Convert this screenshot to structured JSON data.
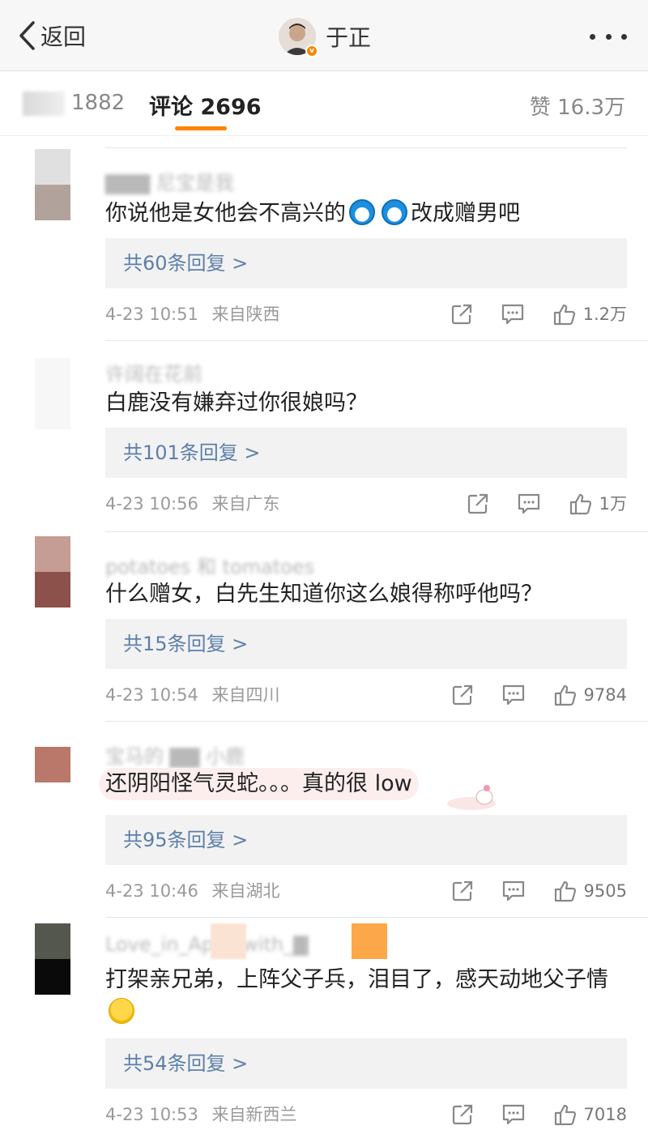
{
  "nav": {
    "back_label": "返回",
    "author_name": "于正",
    "verified_badge": "v"
  },
  "tabs": {
    "repost_count": "1882",
    "comment_label": "评论 2696",
    "likes_label": "赞 16.3万"
  },
  "comments": [
    {
      "text": "你说他是女他会不高兴的",
      "text_after": "改成赠男吧",
      "replies": "共60条回复 >",
      "time": "4-23 10:51",
      "location": "来自陕西",
      "likes": "1.2万"
    },
    {
      "text": "白鹿没有嫌弃过你很娘吗？",
      "replies": "共101条回复 >",
      "time": "4-23 10:56",
      "location": "来自广东",
      "likes": "1万"
    },
    {
      "text": "什么赠女，白先生知道你这么娘得称呼他吗？",
      "replies": "共15条回复 >",
      "time": "4-23 10:54",
      "location": "来自四川",
      "likes": "9784"
    },
    {
      "text": "还阴阳怪气灵蛇。。。真的很 low",
      "replies": "共95条回复 >",
      "time": "4-23 10:46",
      "location": "来自湖北",
      "likes": "9505"
    },
    {
      "text": "打架亲兄弟，上阵父子兵，泪目了，感天动地父子情",
      "replies": "共54条回复 >",
      "time": "4-23 10:53",
      "location": "来自新西兰",
      "likes": "7018"
    }
  ],
  "colors": {
    "accent": "#ff8200",
    "reply_link": "#5d7fa8",
    "meta_gray": "#9a9a9a"
  }
}
